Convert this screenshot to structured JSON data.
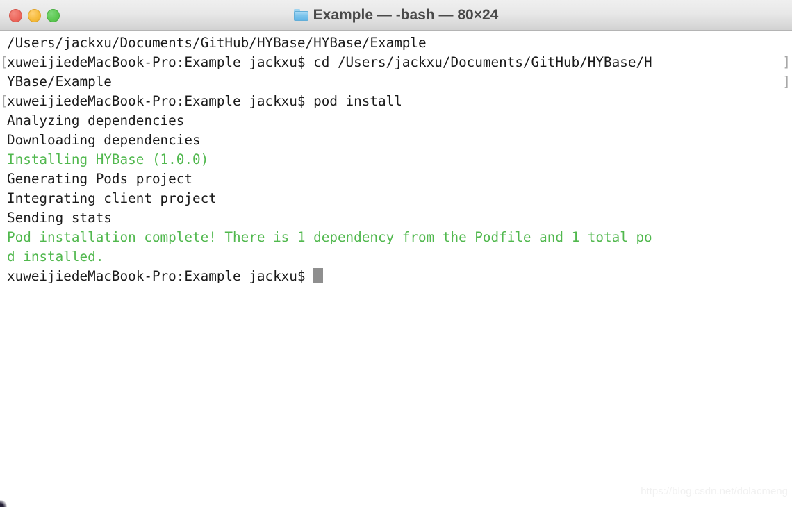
{
  "window": {
    "title": "Example — -bash — 80×24",
    "folder_icon": "folder-icon",
    "controls": {
      "close": "close-button",
      "minimize": "minimize-button",
      "zoom": "zoom-button"
    },
    "accent_green": "#51b84e",
    "cursor_color": "#8f8f8f",
    "titlebar_bg": "#e8e8e8"
  },
  "terminal": {
    "cols": 80,
    "rows": 24,
    "lines": [
      {
        "text": "/Users/jackxu/Documents/GitHub/HYBase/HYBase/Example",
        "color": "default",
        "wrap_left": "",
        "wrap_right": ""
      },
      {
        "text": "xuweijiedeMacBook-Pro:Example jackxu$ cd /Users/jackxu/Documents/GitHub/HYBase/H",
        "color": "default",
        "wrap_left": "[",
        "wrap_right": "]"
      },
      {
        "text": "YBase/Example",
        "color": "default",
        "wrap_left": "",
        "wrap_right": "]"
      },
      {
        "text": "xuweijiedeMacBook-Pro:Example jackxu$ pod install",
        "color": "default",
        "wrap_left": "[",
        "wrap_right": ""
      },
      {
        "text": "Analyzing dependencies",
        "color": "default",
        "wrap_left": "",
        "wrap_right": ""
      },
      {
        "text": "Downloading dependencies",
        "color": "default",
        "wrap_left": "",
        "wrap_right": ""
      },
      {
        "text": "Installing HYBase (1.0.0)",
        "color": "green",
        "wrap_left": "",
        "wrap_right": ""
      },
      {
        "text": "Generating Pods project",
        "color": "default",
        "wrap_left": "",
        "wrap_right": ""
      },
      {
        "text": "Integrating client project",
        "color": "default",
        "wrap_left": "",
        "wrap_right": ""
      },
      {
        "text": "Sending stats",
        "color": "default",
        "wrap_left": "",
        "wrap_right": ""
      },
      {
        "text": "Pod installation complete! There is 1 dependency from the Podfile and 1 total po",
        "color": "green",
        "wrap_left": "",
        "wrap_right": ""
      },
      {
        "text": "d installed.",
        "color": "green",
        "wrap_left": "",
        "wrap_right": ""
      }
    ],
    "prompt_line": {
      "text": "xuweijiedeMacBook-Pro:Example jackxu$ ",
      "color": "default"
    }
  },
  "watermark": {
    "text": "https://blog.csdn.net/dolacmeng"
  }
}
